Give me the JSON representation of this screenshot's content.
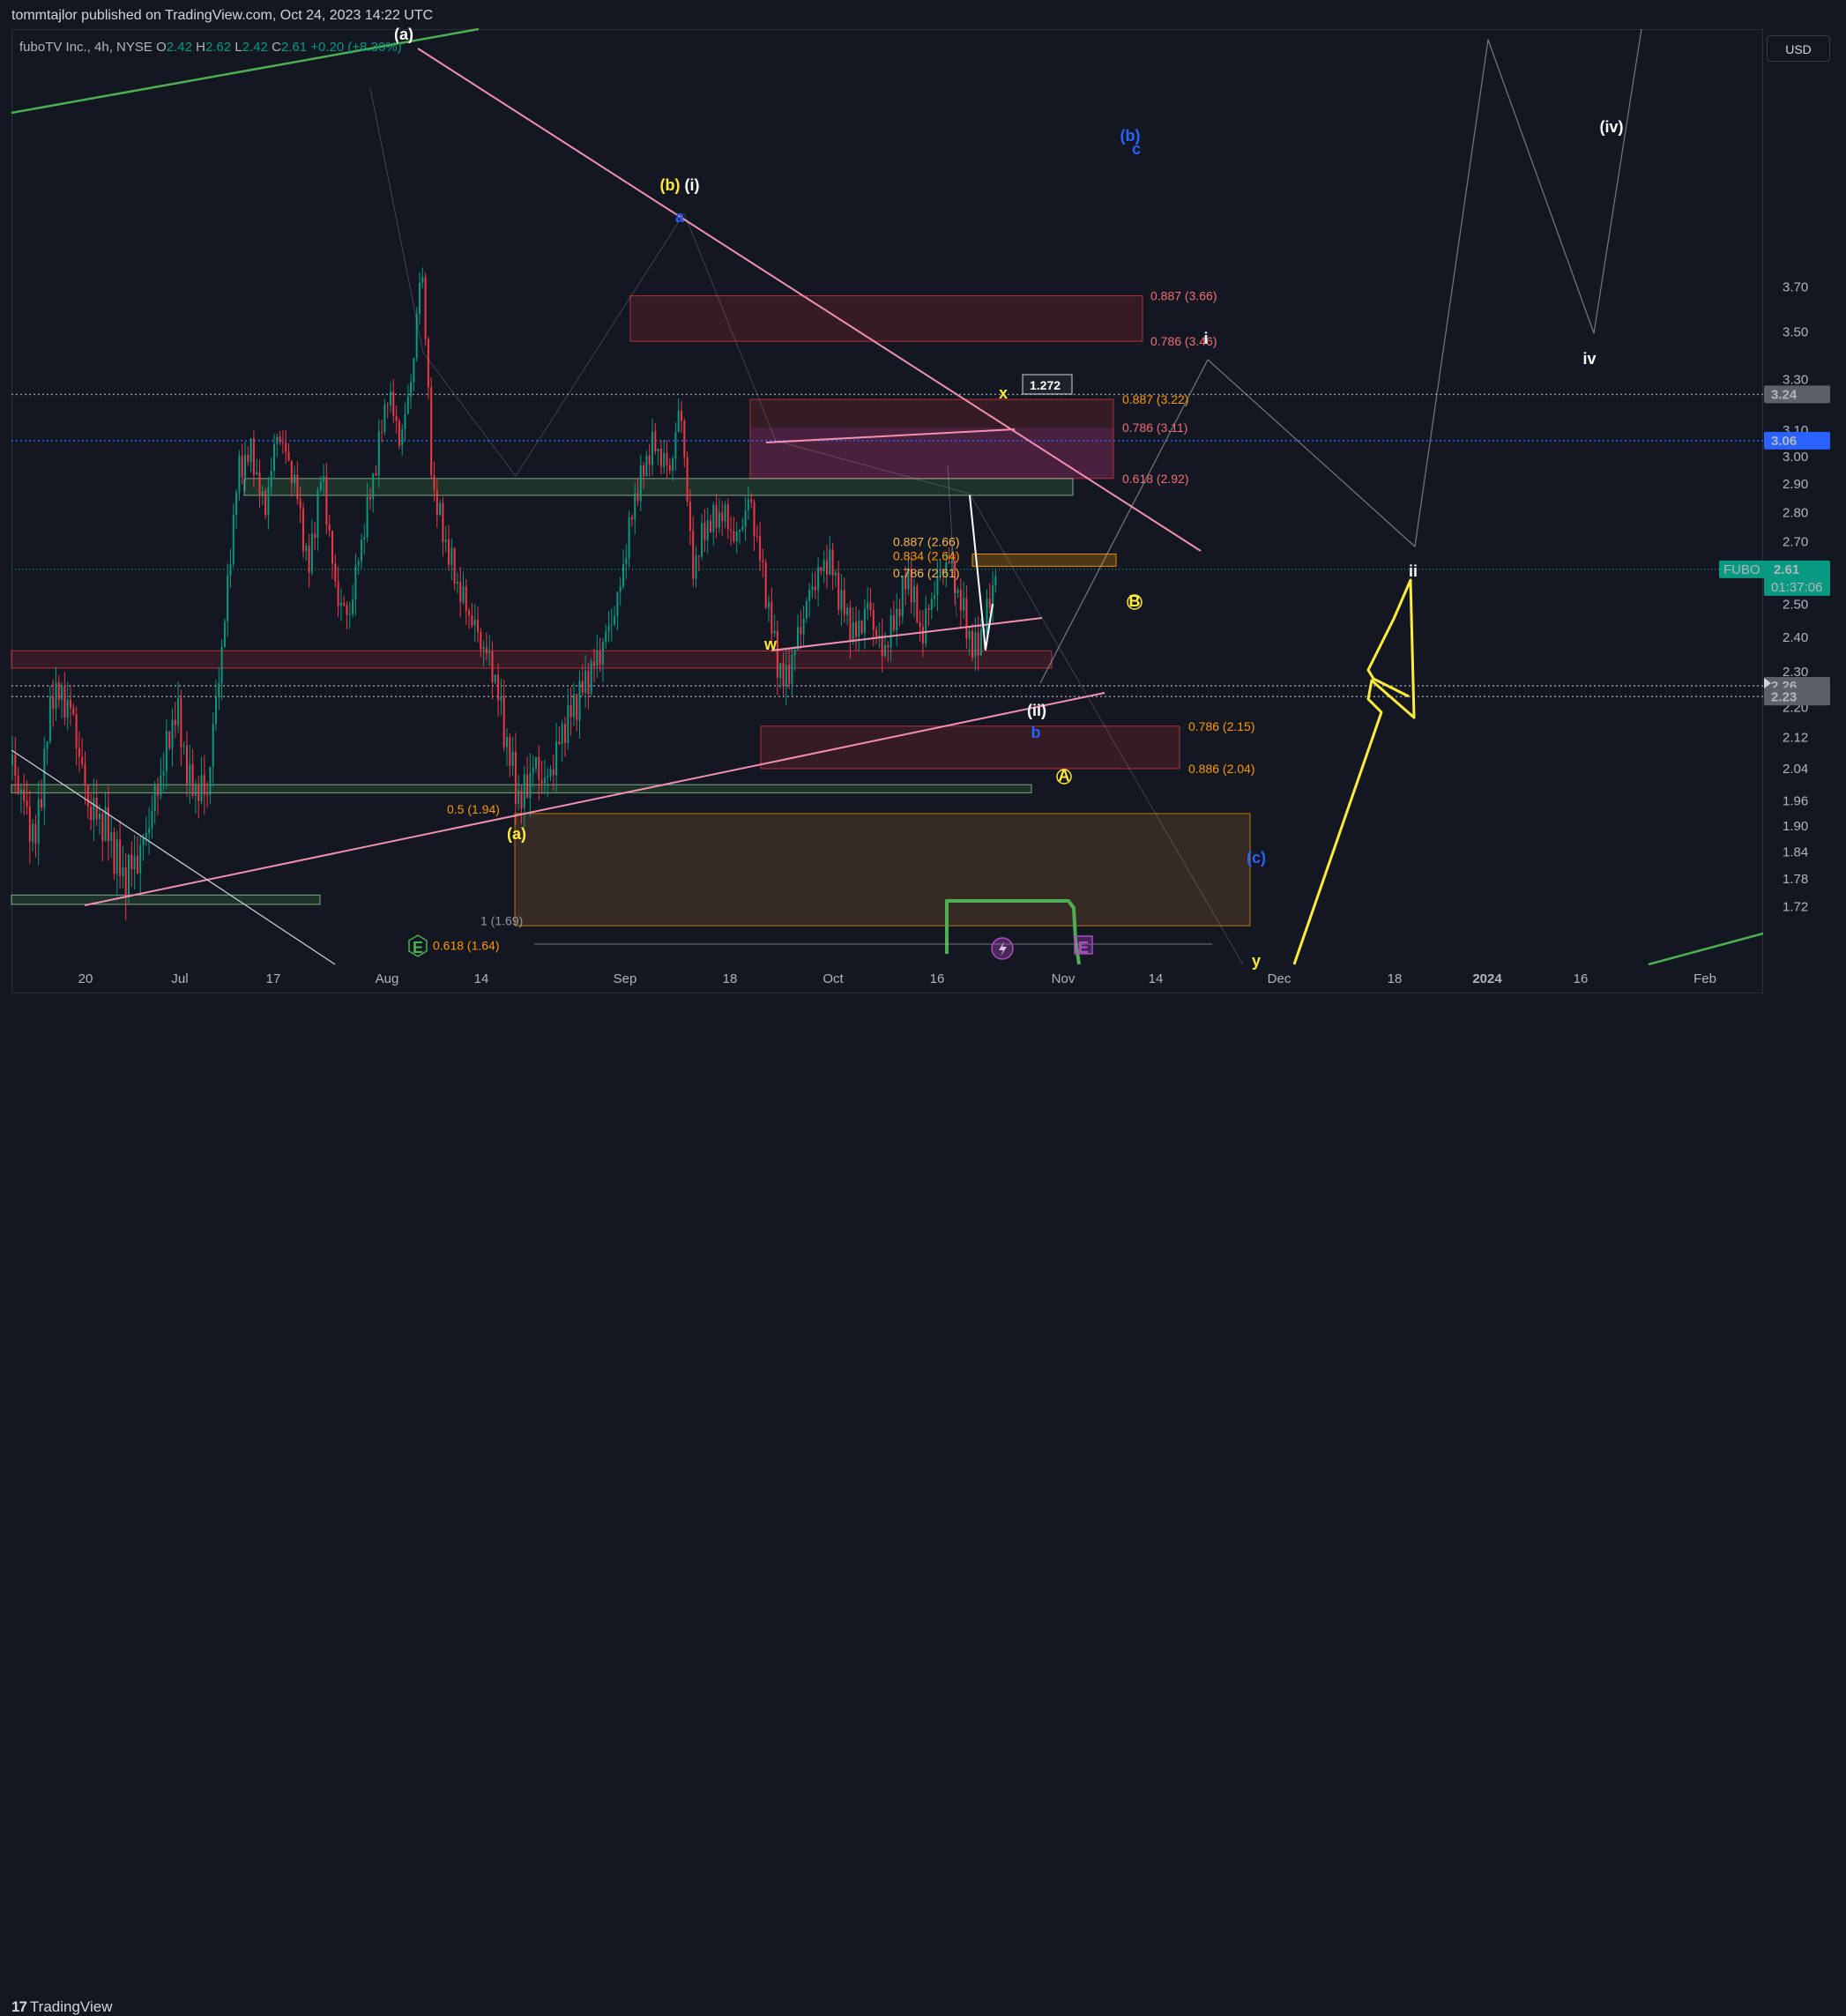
{
  "header": {
    "published": "tommtajlor published on TradingView.com, Oct 24, 2023 14:22 UTC"
  },
  "legend": {
    "symbol": "fuboTV Inc., 4h, NYSE",
    "open_label": "O",
    "open": "2.42",
    "high_label": "H",
    "high": "2.62",
    "low_label": "L",
    "low": "2.42",
    "close_label": "C",
    "close": "2.61",
    "change": "+0.20 (+8.30%)"
  },
  "currency": "USD",
  "footer": {
    "brand_mark": "17",
    "brand": "TradingView"
  },
  "colors": {
    "background": "#131722",
    "up": "#089981",
    "down": "#f23645",
    "pink_line": "#f48fb1",
    "green_line": "#4caf50",
    "yellow": "#ffeb3b",
    "blue_dotted": "#2962ff",
    "fib_red": "#e05454",
    "fib_orange": "#ff9800"
  },
  "chart_data": {
    "type": "candlestick",
    "interval": "4h",
    "ylim": [
      1.68,
      3.88
    ],
    "y_ticks": [
      "3.70",
      "3.50",
      "3.30",
      "3.10",
      "3.00",
      "2.90",
      "2.80",
      "2.70",
      "2.50",
      "2.40",
      "2.30",
      "2.20",
      "2.12",
      "2.04",
      "1.96",
      "1.90",
      "1.84",
      "1.78",
      "1.72"
    ],
    "x_ticks": [
      "20",
      "Jul",
      "17",
      "Aug",
      "14",
      "Sep",
      "18",
      "Oct",
      "16",
      "Nov",
      "14",
      "Dec",
      "18",
      "2024",
      "16",
      "Feb"
    ],
    "x_ticks_bold": [
      "2024"
    ],
    "price_labels": [
      {
        "value": "3.24",
        "kind": "gray"
      },
      {
        "value": "3.06",
        "kind": "blue"
      },
      {
        "value": "2.26",
        "kind": "gray"
      },
      {
        "value": "2.23",
        "kind": "gray"
      }
    ],
    "last_price": {
      "ticker": "FUBO",
      "value": "2.61",
      "countdown": "01:37:06"
    },
    "horizontal_levels": [
      3.24,
      3.06,
      2.61,
      2.26,
      2.23
    ],
    "zones": [
      {
        "from": 3.46,
        "to": 3.66,
        "color": "red"
      },
      {
        "from": 2.92,
        "to": 3.22,
        "color": "red"
      },
      {
        "from": 2.86,
        "to": 2.92,
        "color": "green"
      },
      {
        "from": 2.62,
        "to": 2.66,
        "color": "orange"
      },
      {
        "from": 2.31,
        "to": 2.36,
        "color": "red"
      },
      {
        "from": 2.04,
        "to": 2.15,
        "color": "red"
      },
      {
        "from": 1.98,
        "to": 2.0,
        "color": "green"
      },
      {
        "from": 1.68,
        "to": 1.93,
        "color": "brown"
      },
      {
        "from": 1.725,
        "to": 1.745,
        "color": "green"
      }
    ],
    "fib_labels": [
      {
        "text": "0.887 (3.66)",
        "price": 3.66,
        "color": "red"
      },
      {
        "text": "0.786 (3.46)",
        "price": 3.46,
        "color": "red"
      },
      {
        "text": "0.887 (3.22)",
        "price": 3.22,
        "color": "orange"
      },
      {
        "text": "0.786 (3.11)",
        "price": 3.11,
        "color": "red"
      },
      {
        "text": "0.618 (2.92)",
        "price": 2.92,
        "color": "red"
      },
      {
        "text": "0.887 (2.66)",
        "price": 2.66,
        "color": "yellow"
      },
      {
        "text": "0.834 (2.64)",
        "price": 2.64,
        "color": "orange"
      },
      {
        "text": "0.786 (2.61)",
        "price": 2.61,
        "color": "yellow"
      },
      {
        "text": "0.786 (2.15)",
        "price": 2.15,
        "color": "orange"
      },
      {
        "text": "0.886 (2.04)",
        "price": 2.04,
        "color": "orange"
      },
      {
        "text": "0.5 (1.94)",
        "price": 1.94,
        "color": "orange"
      },
      {
        "text": "1 (1.69)",
        "price": 1.69,
        "color": "gray"
      },
      {
        "text": "0.618 (1.64)",
        "price": 1.64,
        "color": "orange"
      }
    ],
    "extension_label": "1.272",
    "wave_labels": [
      {
        "text": "(a)",
        "color": "white"
      },
      {
        "text": "(b)",
        "color": "yellow"
      },
      {
        "text": "(i)",
        "color": "white"
      },
      {
        "text": "a",
        "color": "blue"
      },
      {
        "text": "(b)",
        "color": "blue"
      },
      {
        "text": "c",
        "color": "blue"
      },
      {
        "text": "x",
        "color": "yellow"
      },
      {
        "text": "w",
        "color": "yellow"
      },
      {
        "text": "i",
        "color": "white"
      },
      {
        "text": "(ii)",
        "color": "white"
      },
      {
        "text": "b",
        "color": "blue"
      },
      {
        "text": "B",
        "color": "yellow"
      },
      {
        "text": "A",
        "color": "yellow"
      },
      {
        "text": "(a)",
        "color": "yellow"
      },
      {
        "text": "(c)",
        "color": "blue"
      },
      {
        "text": "ii",
        "color": "white"
      },
      {
        "text": "(iv)",
        "color": "white"
      },
      {
        "text": "iv",
        "color": "white"
      },
      {
        "text": "y",
        "color": "yellow"
      },
      {
        "text": "E",
        "color": "green"
      },
      {
        "text": "E",
        "color": "purple"
      }
    ]
  }
}
